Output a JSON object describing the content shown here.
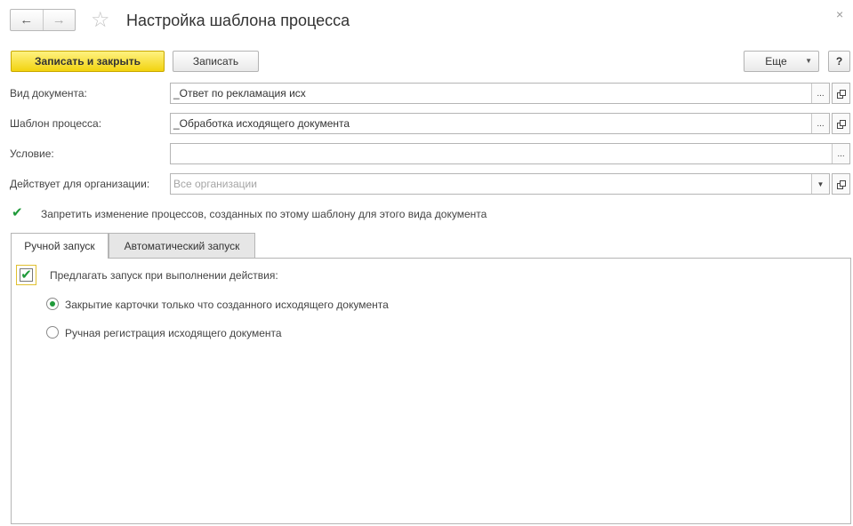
{
  "window": {
    "title": "Настройка шаблона процесса",
    "back_icon": "←",
    "forward_icon": "→",
    "star_icon": "☆",
    "close_icon": "×"
  },
  "toolbar": {
    "save_close_label": "Записать и закрыть",
    "save_label": "Записать",
    "more_label": "Еще",
    "more_arrow": "▼",
    "help_label": "?"
  },
  "form": {
    "doc_type": {
      "label": "Вид документа:",
      "value": "_Ответ по рекламация исх",
      "choose": "..."
    },
    "template": {
      "label": "Шаблон процесса:",
      "value": "_Обработка исходящего документа",
      "choose": "..."
    },
    "condition": {
      "label": "Условие:",
      "value": "",
      "choose": "..."
    },
    "organization": {
      "label": "Действует для организации:",
      "placeholder": "Все организации",
      "dropdown": "▼"
    },
    "forbid_change": {
      "label": "Запретить изменение процессов, созданных по этому шаблону для этого вида документа",
      "checked": true,
      "mark": "✔"
    }
  },
  "tabs": [
    {
      "label": "Ручной запуск",
      "active": true
    },
    {
      "label": "Автоматический запуск",
      "active": false
    }
  ],
  "manual": {
    "offer_start": {
      "label": "Предлагать запуск при выполнении действия:",
      "checked": true,
      "mark": "✔"
    },
    "options": [
      {
        "label": "Закрытие карточки только что созданного исходящего документа",
        "selected": true
      },
      {
        "label": "Ручная регистрация исходящего документа",
        "selected": false
      }
    ]
  },
  "colors": {
    "primary_button": "#f2d30f",
    "check_green": "#1f9a3a"
  }
}
